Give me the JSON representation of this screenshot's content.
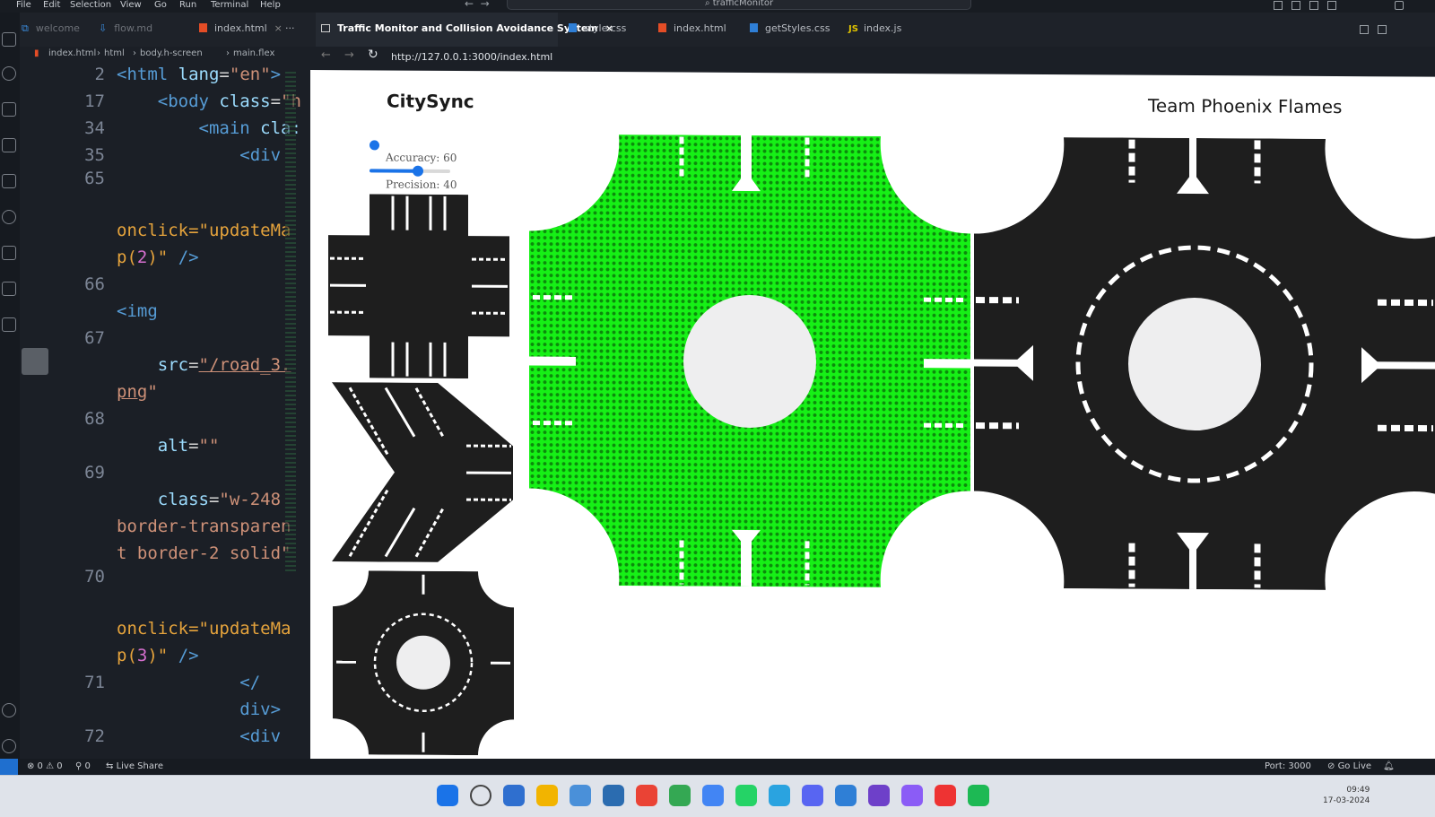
{
  "menu": [
    "File",
    "Edit",
    "Selection",
    "View",
    "Go",
    "Run",
    "Terminal",
    "Help"
  ],
  "command_center": "trafficMonitor",
  "editor_tabs": [
    {
      "label": "welcome",
      "icon": "vscode-icon"
    },
    {
      "label": "flow.md",
      "icon": "markdown-icon"
    },
    {
      "label": "index.html",
      "icon": "html-icon"
    }
  ],
  "tab_overflow": "···",
  "browser_tabs": [
    {
      "label": "Traffic Monitor and Collision Avoidance System",
      "icon": "browser-icon",
      "active": true
    },
    {
      "label": "style.css",
      "icon": "css-icon"
    },
    {
      "label": "index.html",
      "icon": "html-icon"
    },
    {
      "label": "getStyles.css",
      "icon": "css-icon"
    },
    {
      "label": "index.js",
      "icon": "js-icon"
    }
  ],
  "breadcrumb": [
    "index.html",
    "html",
    "body.h-screen",
    "main.flex"
  ],
  "address": "http://127.0.0.1:3000/index.html",
  "code_lines": [
    {
      "n": "2",
      "html": "<span class=\"tag\">&lt;html</span> <span class=\"att\">lang</span>=<span class=\"str\">\"en\"</span><span class=\"tag\">&gt;</span>"
    },
    {
      "n": "17",
      "html": "    <span class=\"tag\">&lt;body</span> <span class=\"att\">class</span>=<span class=\"str\">\"h</span>"
    },
    {
      "n": "34",
      "html": "        <span class=\"tag\">&lt;main</span> <span class=\"att\">cla:</span>"
    },
    {
      "n": "35",
      "html": "            <span class=\"tag\">&lt;div</span>"
    },
    {
      "n": "65",
      "html": ""
    },
    {
      "n": "",
      "html": ""
    },
    {
      "n": "",
      "html": "<span class=\"orn\">onclick=\"updateMa</span>"
    },
    {
      "n": "",
      "html": "<span class=\"orn\">p(</span><span class=\"brk\">2</span><span class=\"orn\">)\"</span> <span class=\"tag\">/&gt;</span>"
    },
    {
      "n": "66",
      "html": ""
    },
    {
      "n": "",
      "html": "<span class=\"tag\">&lt;img</span>"
    },
    {
      "n": "67",
      "html": ""
    },
    {
      "n": "",
      "html": "    <span class=\"att\">src</span>=<span class=\"str\"><u>\"/road_3.</u></span>"
    },
    {
      "n": "",
      "html": "<span class=\"str\"><u>png</u>\"</span>"
    },
    {
      "n": "68",
      "html": ""
    },
    {
      "n": "",
      "html": "    <span class=\"att\">alt</span>=<span class=\"str\">\"\"</span>"
    },
    {
      "n": "69",
      "html": ""
    },
    {
      "n": "",
      "html": "    <span class=\"att\">class</span>=<span class=\"str\">\"w-248</span>"
    },
    {
      "n": "",
      "html": "<span class=\"str\">border-transparen</span>"
    },
    {
      "n": "",
      "html": "<span class=\"str\">t border-2 solid\"</span>"
    },
    {
      "n": "70",
      "html": ""
    },
    {
      "n": "",
      "html": ""
    },
    {
      "n": "",
      "html": "<span class=\"orn\">onclick=\"updateMa</span>"
    },
    {
      "n": "",
      "html": "<span class=\"orn\">p(</span><span class=\"brk\">3</span><span class=\"orn\">)\"</span> <span class=\"tag\">/&gt;</span>"
    },
    {
      "n": "71",
      "html": "            <span class=\"tag\">&lt;/</span>"
    },
    {
      "n": "",
      "html": "            <span class=\"tag\">div&gt;</span>"
    },
    {
      "n": "72",
      "html": "            <span class=\"tag\">&lt;div</span>"
    }
  ],
  "app": {
    "brand": "CitySync",
    "team": "Team Phoenix Flames"
  },
  "sliders": [
    {
      "label": "Accuracy: 60",
      "value": 60
    },
    {
      "label": "Precision: 40",
      "value": 40
    }
  ],
  "map_thumbs": [
    "four-way-intersection",
    "y-junction",
    "roundabout"
  ],
  "status": {
    "problems": "⊗ 0 ⚠ 0",
    "ports": "⚲ 0",
    "live_share": "Live Share",
    "port": "Port: 3000",
    "go_live": "Go Live"
  },
  "clock": {
    "time": "09:49",
    "date": "17-03-2024"
  },
  "colors": {
    "overlay": "#16f016",
    "road": "#1e1e1e",
    "marking": "#ffffff",
    "island": "#eeeeef"
  }
}
